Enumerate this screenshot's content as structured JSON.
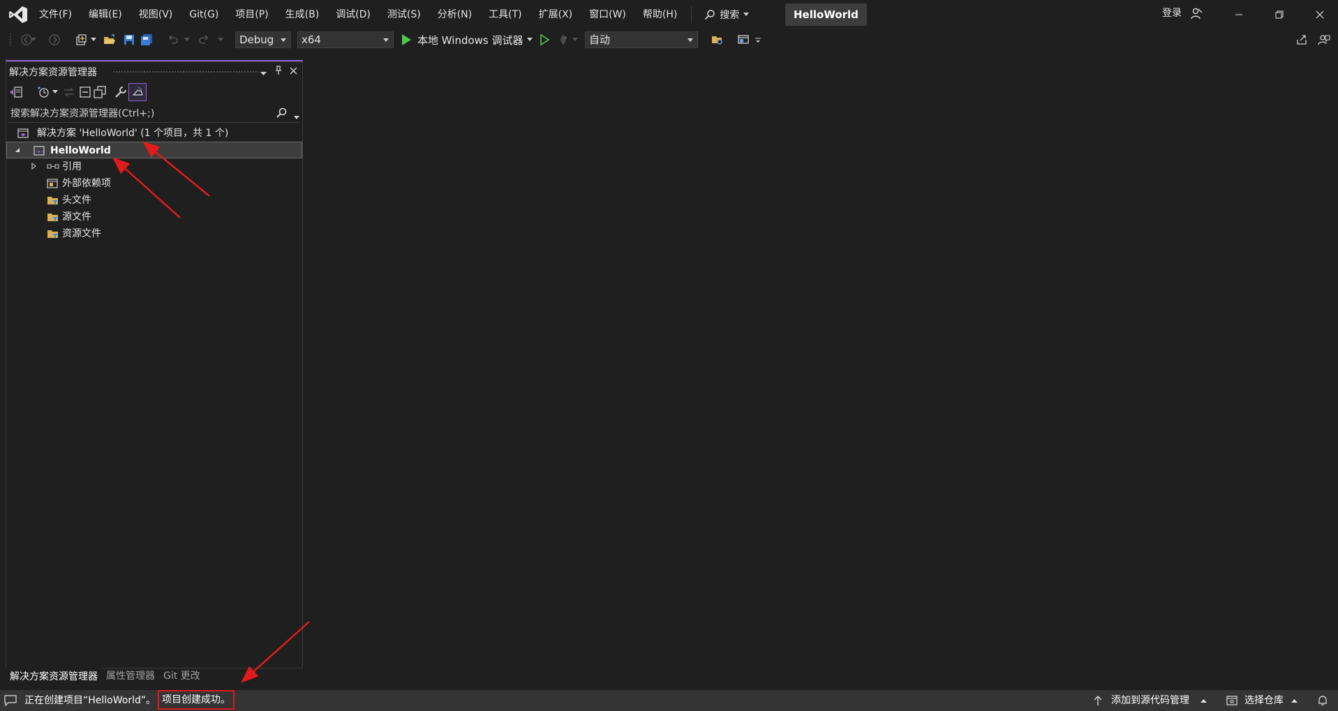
{
  "app": {
    "title": "HelloWorld",
    "login_label": "登录"
  },
  "menu": [
    {
      "label": "文件(F)"
    },
    {
      "label": "编辑(E)"
    },
    {
      "label": "视图(V)"
    },
    {
      "label": "Git(G)"
    },
    {
      "label": "项目(P)"
    },
    {
      "label": "生成(B)"
    },
    {
      "label": "调试(D)"
    },
    {
      "label": "测试(S)"
    },
    {
      "label": "分析(N)"
    },
    {
      "label": "工具(T)"
    },
    {
      "label": "扩展(X)"
    },
    {
      "label": "窗口(W)"
    },
    {
      "label": "帮助(H)"
    }
  ],
  "search_menu_label": "搜索",
  "toolbar": {
    "configuration": "Debug",
    "platform": "x64",
    "run_target": "本地 Windows 调试器",
    "mode": "自动"
  },
  "solution_explorer": {
    "title": "解决方案资源管理器",
    "search_placeholder": "搜索解决方案资源管理器(Ctrl+;)",
    "solution_label": "解决方案 'HelloWorld' (1 个项目，共 1 个)",
    "project_label": "HelloWorld",
    "items": [
      {
        "label": "引用",
        "icon": "references-icon"
      },
      {
        "label": "外部依赖项",
        "icon": "external-dependencies-icon"
      },
      {
        "label": "头文件",
        "icon": "filter-folder-icon"
      },
      {
        "label": "源文件",
        "icon": "filter-folder-icon"
      },
      {
        "label": "资源文件",
        "icon": "filter-folder-icon"
      }
    ],
    "tabs": [
      {
        "label": "解决方案资源管理器",
        "active": true
      },
      {
        "label": "属性管理器",
        "active": false
      },
      {
        "label": "Git 更改",
        "active": false
      }
    ]
  },
  "statusbar": {
    "message_prefix": "正在创建项目“HelloWorld”。",
    "message_highlight": "项目创建成功。",
    "add_to_source_control": "添加到源代码管理",
    "select_repository": "选择仓库"
  },
  "colors": {
    "background": "#1f1f1f",
    "statusbar": "#343434",
    "accent": "#8d63d0",
    "annotation": "#e01b1b",
    "run_green": "#4ec94e"
  }
}
